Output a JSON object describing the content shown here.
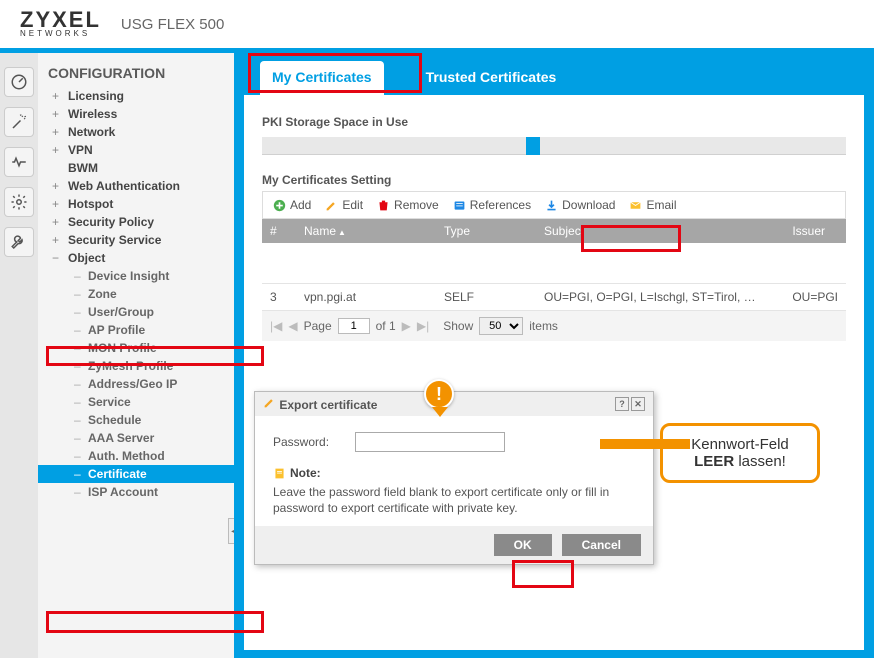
{
  "header": {
    "logo_main": "ZYXEL",
    "logo_sub": "NETWORKS",
    "model": "USG FLEX 500"
  },
  "sidebar": {
    "heading": "CONFIGURATION",
    "items": [
      {
        "label": "Licensing",
        "glyph": "+"
      },
      {
        "label": "Wireless",
        "glyph": "+"
      },
      {
        "label": "Network",
        "glyph": "+"
      },
      {
        "label": "VPN",
        "glyph": "+"
      },
      {
        "label": "BWM",
        "glyph": " "
      },
      {
        "label": "Web Authentication",
        "glyph": "+"
      },
      {
        "label": "Hotspot",
        "glyph": "+"
      },
      {
        "label": "Security Policy",
        "glyph": "+"
      },
      {
        "label": "Security Service",
        "glyph": "+"
      },
      {
        "label": "Object",
        "glyph": "−"
      }
    ],
    "object_children": [
      {
        "label": "Device Insight"
      },
      {
        "label": "Zone"
      },
      {
        "label": "User/Group"
      },
      {
        "label": "AP Profile"
      },
      {
        "label": "MON Profile"
      },
      {
        "label": "ZyMesh Profile"
      },
      {
        "label": "Address/Geo IP"
      },
      {
        "label": "Service"
      },
      {
        "label": "Schedule"
      },
      {
        "label": "AAA Server"
      },
      {
        "label": "Auth. Method"
      },
      {
        "label": "Certificate"
      },
      {
        "label": "ISP Account"
      }
    ]
  },
  "tabs": {
    "active": "My Certificates",
    "inactive": "Trusted Certificates"
  },
  "panel": {
    "storage_title": "PKI Storage Space in Use",
    "table_section_title": "My Certificates Setting",
    "toolbar": {
      "add": "Add",
      "edit": "Edit",
      "remove": "Remove",
      "references": "References",
      "download": "Download",
      "email": "Email"
    },
    "columns": {
      "idx": "#",
      "name": "Name",
      "type": "Type",
      "subject": "Subject",
      "issuer": "Issuer"
    },
    "row": {
      "idx": "3",
      "name": "vpn.pgi.at",
      "type": "SELF",
      "subject": "OU=PGI, O=PGI, L=Ischgl, ST=Tirol, …",
      "issuer": "OU=PGI"
    },
    "pager": {
      "page_label_pre": "Page",
      "page_value": "1",
      "page_label_post": "of 1",
      "show_label": "Show",
      "show_value": "50",
      "items_label": "items"
    }
  },
  "dialog": {
    "title": "Export certificate",
    "password_label": "Password:",
    "password_value": "",
    "note_label": "Note:",
    "note_text": "Leave the password field blank to export certificate only or fill in password to export certificate with private key.",
    "ok": "OK",
    "cancel": "Cancel"
  },
  "callout": {
    "line1": "Kennwort-Feld",
    "line2_bold": "LEER",
    "line2_rest": " lassen!"
  }
}
